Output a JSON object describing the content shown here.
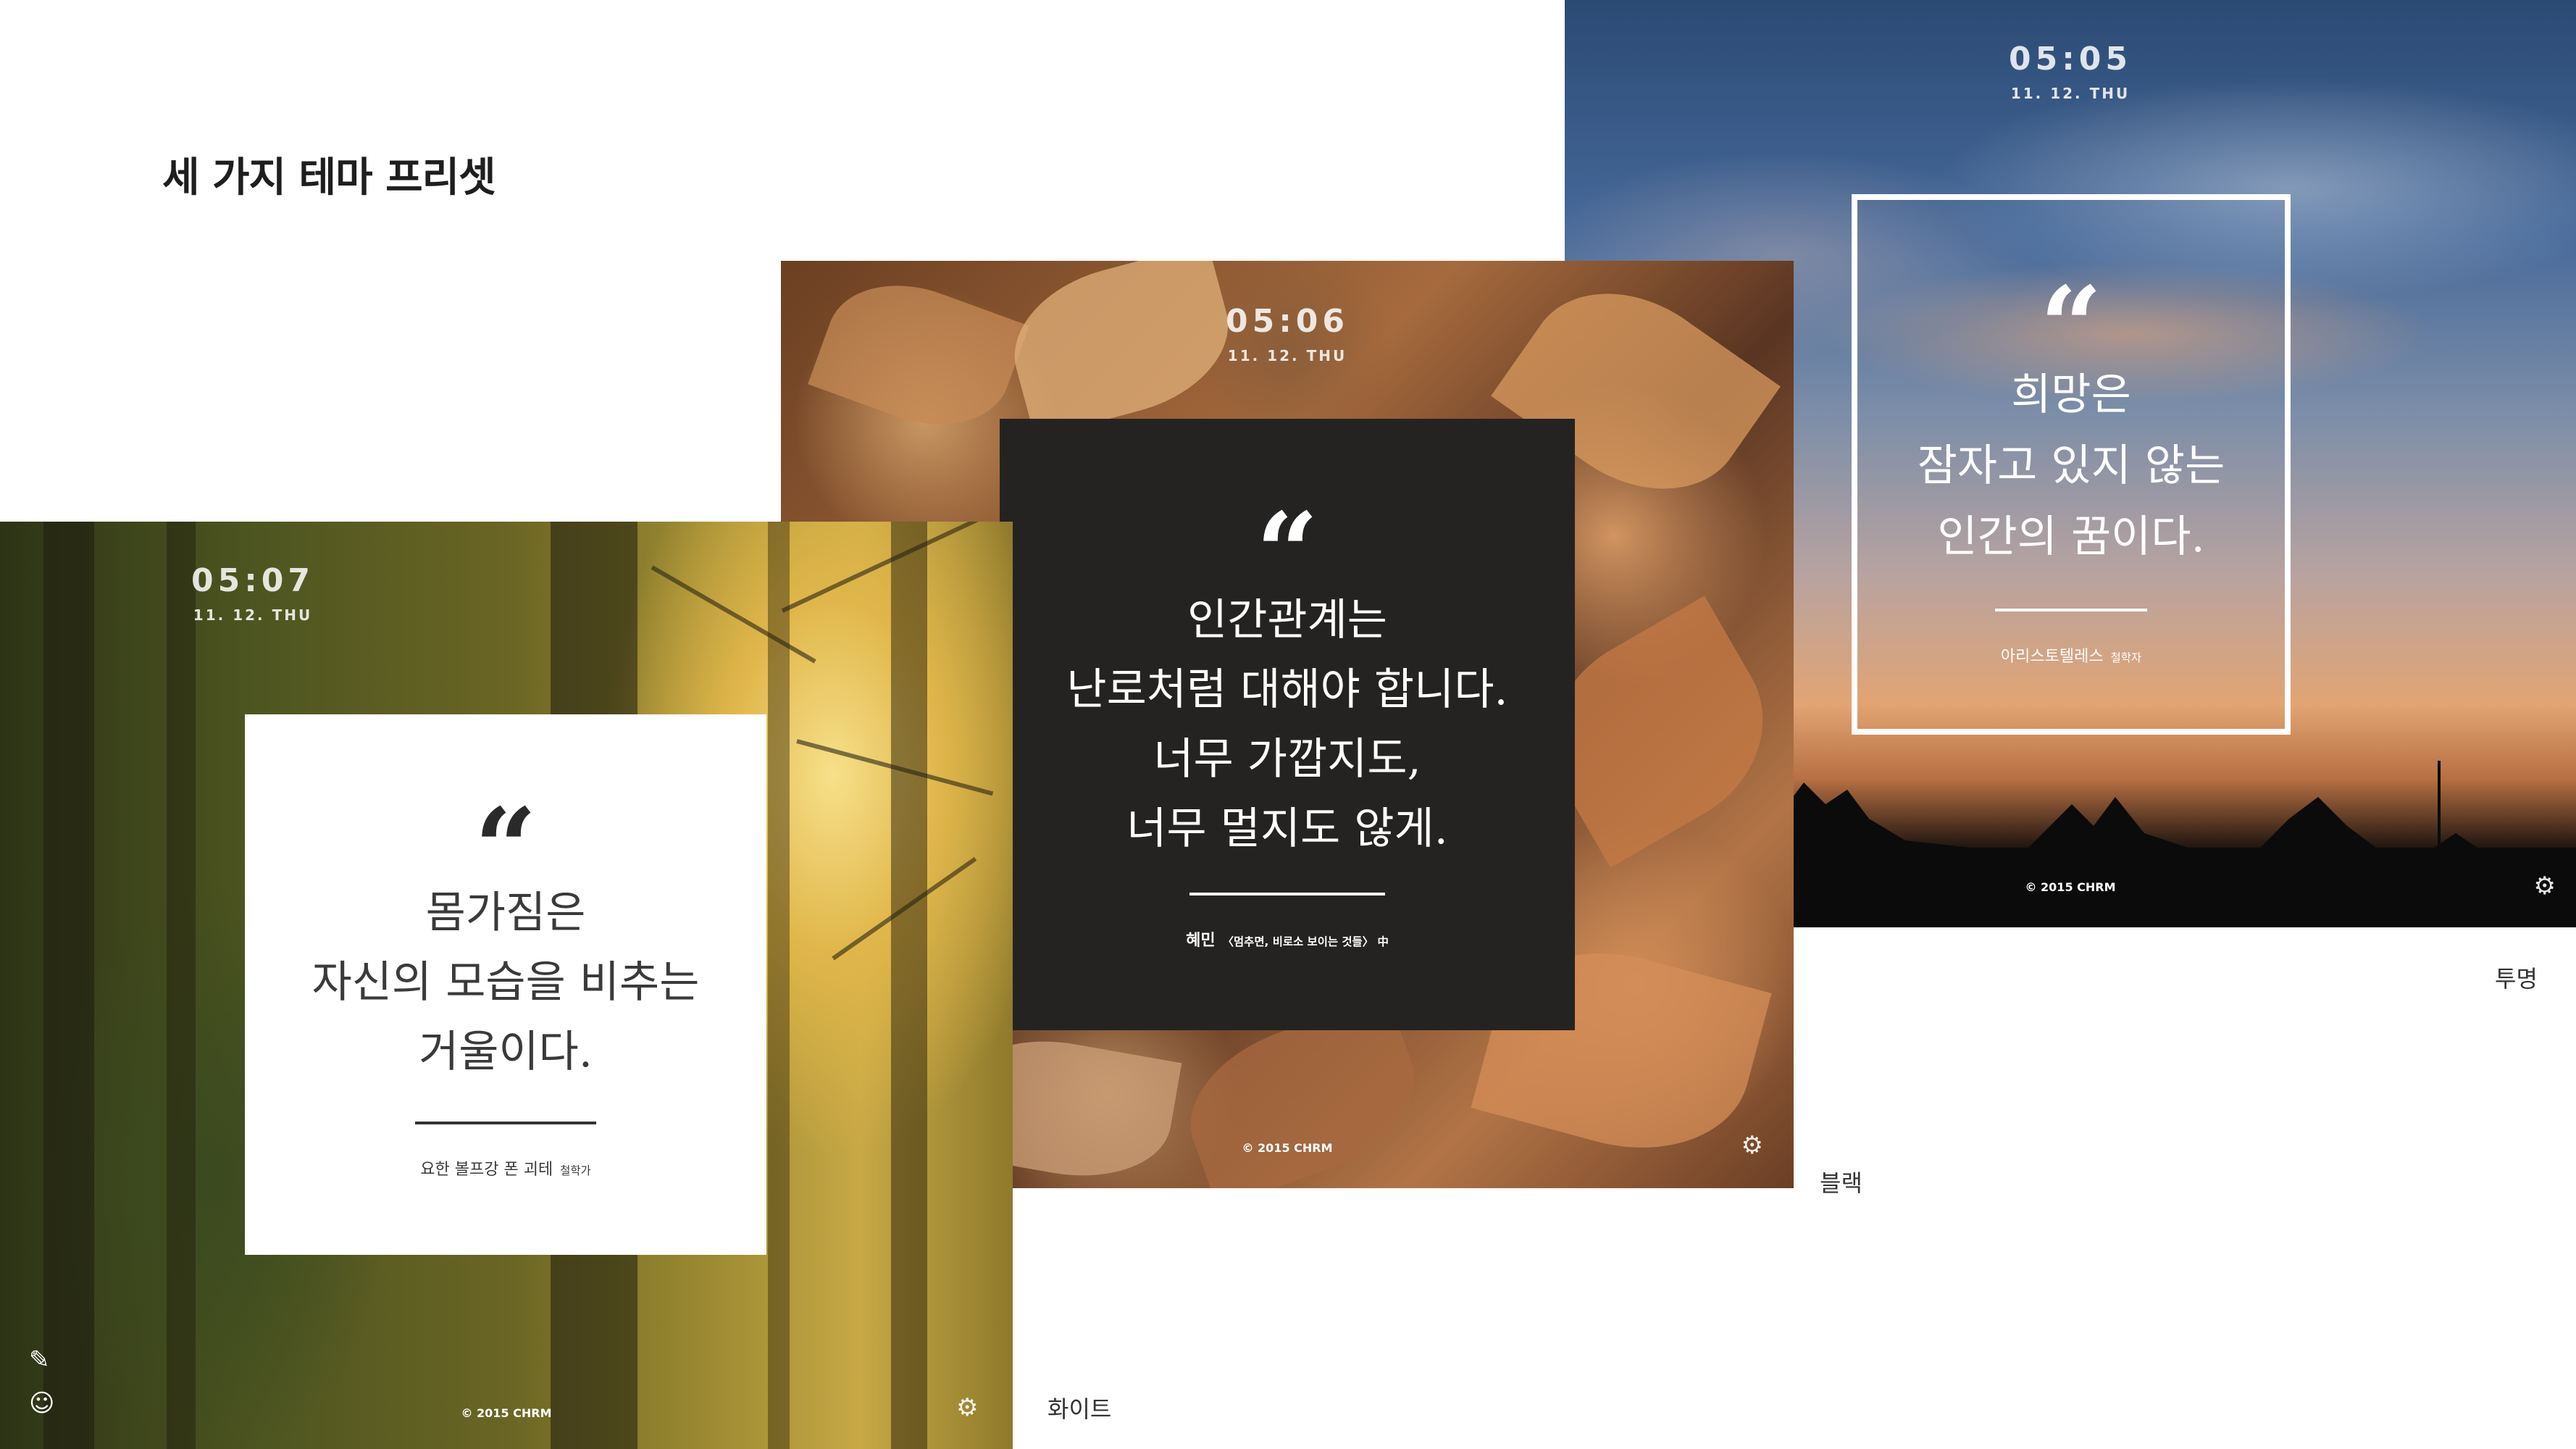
{
  "page": {
    "title": "세 가지 테마 프리셋"
  },
  "themes": [
    {
      "id": "transparent",
      "caption": "투명",
      "clock": {
        "time": "05:05",
        "date": "11. 12. THU"
      },
      "quote": {
        "mark": "“",
        "lines": [
          "희망은",
          "잠자고 있지 않는",
          "인간의 꿈이다."
        ],
        "author": "아리스토텔레스",
        "author_role": "철학자"
      },
      "copyright": "© 2015 CHRM",
      "icons": [
        "settings-icon"
      ]
    },
    {
      "id": "black",
      "caption": "블랙",
      "clock": {
        "time": "05:06",
        "date": "11. 12. THU"
      },
      "quote": {
        "mark": "“",
        "lines": [
          "인간관계는",
          "난로처럼 대해야 합니다.",
          "너무 가깝지도,",
          "너무 멀지도 않게."
        ],
        "author": "혜민",
        "author_role": "〈멈추면, 비로소 보이는 것들〉 中"
      },
      "copyright": "© 2015 CHRM",
      "icons": [
        "settings-icon"
      ]
    },
    {
      "id": "white",
      "caption": "화이트",
      "clock": {
        "time": "05:07",
        "date": "11. 12. THU"
      },
      "quote": {
        "mark": "“",
        "lines": [
          "몸가짐은",
          "자신의 모습을 비추는",
          "거울이다."
        ],
        "author": "요한 볼프강 폰 괴테",
        "author_role": "철학가"
      },
      "copyright": "© 2015 CHRM",
      "icons": [
        "pencil-icon",
        "smiley-icon",
        "settings-icon"
      ]
    }
  ],
  "colors": {
    "black_card": "#252321",
    "white_card": "#ffffff",
    "transparent_border": "#ffffff"
  }
}
